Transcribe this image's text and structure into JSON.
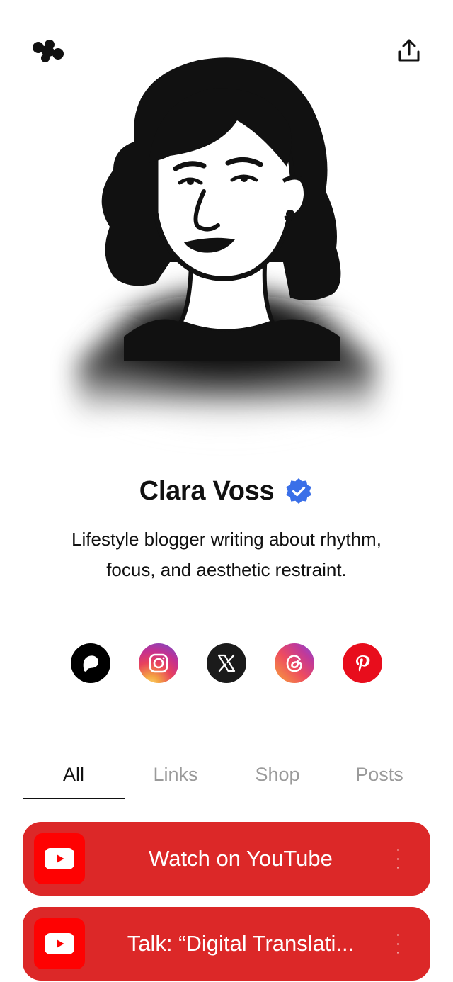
{
  "profile": {
    "name": "Clara Voss",
    "verified": true,
    "bio_line1": "Lifestyle blogger writing about rhythm,",
    "bio_line2": "focus, and aesthetic restraint.",
    "accent_color": "#3a6fe8"
  },
  "header": {
    "left_icon": "linktree-style-logo-icon",
    "right_icon": "share-upload-icon"
  },
  "socials": [
    {
      "name": "Patreon",
      "icon": "patreon-icon",
      "color": "#000000"
    },
    {
      "name": "Instagram",
      "icon": "instagram-icon",
      "color": "#e8425c"
    },
    {
      "name": "X",
      "icon": "x-icon",
      "color": "#1b1b1b"
    },
    {
      "name": "Threads",
      "icon": "threads-icon",
      "color": "#c0399a"
    },
    {
      "name": "Pinterest",
      "icon": "pinterest-icon",
      "color": "#e80d1c"
    }
  ],
  "tabs": [
    {
      "label": "All",
      "active": true
    },
    {
      "label": "Links",
      "active": false
    },
    {
      "label": "Shop",
      "active": false
    },
    {
      "label": "Posts",
      "active": false
    }
  ],
  "links": [
    {
      "label": "Watch on YouTube",
      "icon": "youtube-icon",
      "color": "#dc2828"
    },
    {
      "label": "Talk: “Digital Translati...",
      "icon": "youtube-icon",
      "color": "#dc2828"
    }
  ]
}
